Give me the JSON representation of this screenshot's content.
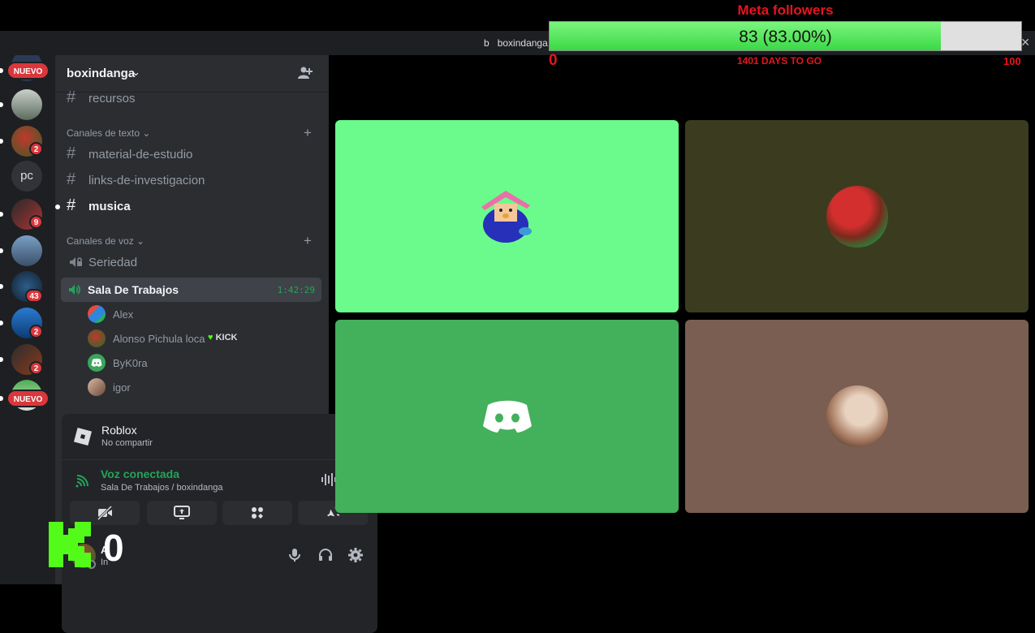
{
  "meta": {
    "title": "Meta followers",
    "bar_label": "83 (83.00%)",
    "progress_fraction": 0.83,
    "min_label": "0",
    "days_label": "1401 DAYS TO GO",
    "max_label": "100",
    "accent": "#e8141e"
  },
  "window": {
    "title_prefix": "b",
    "title": "boxindanga"
  },
  "rail": {
    "top_badge": "NUEVO",
    "pc_label": "pc",
    "badges": [
      "2",
      "9",
      "43",
      "2",
      "2"
    ],
    "bottom_badge": "NUEVO"
  },
  "guild": {
    "name": "boxindanga",
    "channels_top": [
      {
        "name": "recursos"
      }
    ],
    "text_category": "Canales de texto",
    "text_channels": [
      {
        "name": "material-de-estudio"
      },
      {
        "name": "links-de-investigacion"
      },
      {
        "name": "musica"
      }
    ],
    "voice_category": "Canales de voz",
    "voice_channels": [
      {
        "name": "Seriedad"
      },
      {
        "name": "Sala De Trabajos",
        "timer": "1:42:29"
      }
    ],
    "members": [
      {
        "name": "Alex"
      },
      {
        "name": "Alonso Pichula loca",
        "tag": "KICK"
      },
      {
        "name": "ByK0ra"
      },
      {
        "name": "igor"
      }
    ]
  },
  "activity": {
    "title": "Roblox",
    "subtitle": "No compartir"
  },
  "voice": {
    "status": "Voz conectada",
    "location": "Sala De Trabajos / boxindanga"
  },
  "user": {
    "name": "A",
    "status": "In"
  },
  "kick_overlay": {
    "count": "0"
  },
  "colors": {
    "tile1": "#6afb8c",
    "tile2": "#3b3c1f",
    "tile3": "#43b05c",
    "tile4": "#7a5e52",
    "voice_green": "#23a55a"
  }
}
